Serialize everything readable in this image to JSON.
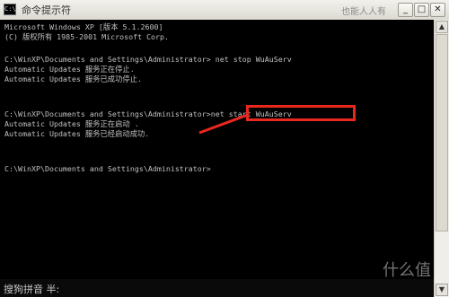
{
  "window": {
    "title": "命令提示符",
    "icon_label": "C:\\",
    "watermark_top": "也能人人有",
    "buttons": {
      "minimize": "_",
      "maximize": "□",
      "close": "✕"
    }
  },
  "console": {
    "lines": [
      "Microsoft Windows XP [版本 5.1.2600]",
      "(C) 版权所有 1985-2001 Microsoft Corp.",
      "",
      "C:\\WinXP\\Documents and Settings\\Administrator> net stop WuAuServ",
      "Automatic Updates 服务正在停止.",
      "Automatic Updates 服务已成功停止.",
      "",
      "",
      "C:\\WinXP\\Documents and Settings\\Administrator>net start WuAuServ",
      "Automatic Updates 服务正在启动 .",
      "Automatic Updates 服务已经启动成功.",
      "",
      "",
      "C:\\WinXP\\Documents and Settings\\Administrator>"
    ]
  },
  "ime": {
    "text": "搜狗拼音 半:"
  },
  "watermark_bottom": "什么值",
  "colors": {
    "console_bg": "#000000",
    "console_text": "#c0c0c0",
    "annotation": "#e8281e"
  },
  "icons": {
    "app": "cmd-icon",
    "minimize": "minimize-icon",
    "maximize": "maximize-icon",
    "close": "close-icon",
    "scroll_up": "arrow-up-icon",
    "scroll_down": "arrow-down-icon"
  }
}
